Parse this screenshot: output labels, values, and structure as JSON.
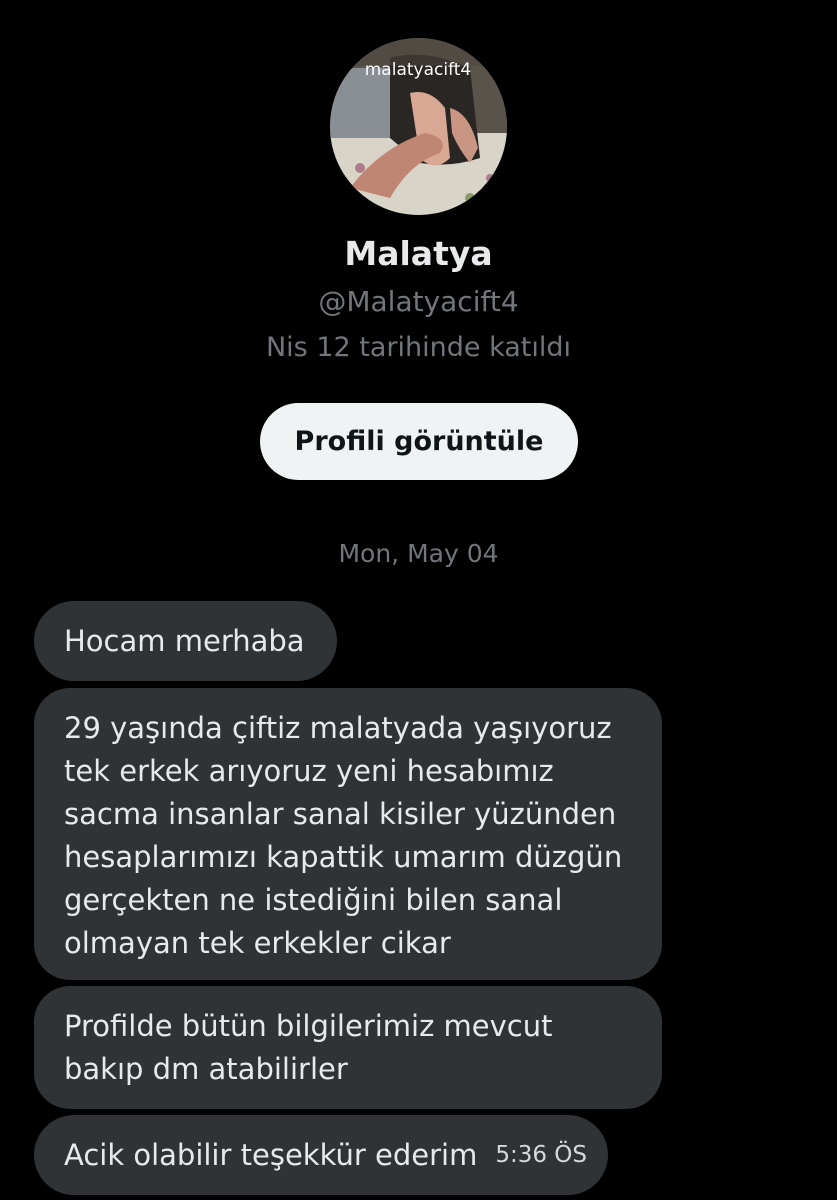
{
  "profile": {
    "avatar_watermark": "malatyacift4",
    "display_name": "Malatya",
    "handle": "@Malatyacift4",
    "joined": "Nis 12 tarihinde katıldı",
    "view_profile_label": "Profili görüntüle"
  },
  "conversation": {
    "date_separator": "Mon, May 04",
    "messages": [
      {
        "lines": [
          "Hocam merhaba"
        ]
      },
      {
        "lines": [
          "29 yaşında çiftiz malatyada yaşıyoruz",
          "tek erkek arıyoruz yeni hesabımız",
          "sacma insanlar sanal kisiler yüzünden",
          "hesaplarımızı kapattik umarım düzgün",
          "gerçekten ne istediğini bilen sanal",
          "olmayan tek erkekler cikar"
        ]
      },
      {
        "lines": [
          "Profilde bütün bilgilerimiz mevcut",
          "bakıp dm atabilirler"
        ]
      },
      {
        "lines": [
          "Acik olabilir teşekkür ederim"
        ],
        "time": "5:36 ÖS"
      }
    ]
  },
  "colors": {
    "background": "#000000",
    "bubble": "#2f3336",
    "primary_text": "#e7e9ea",
    "secondary_text": "#71767b",
    "button_bg": "#eff3f4",
    "button_text": "#0f1419"
  }
}
